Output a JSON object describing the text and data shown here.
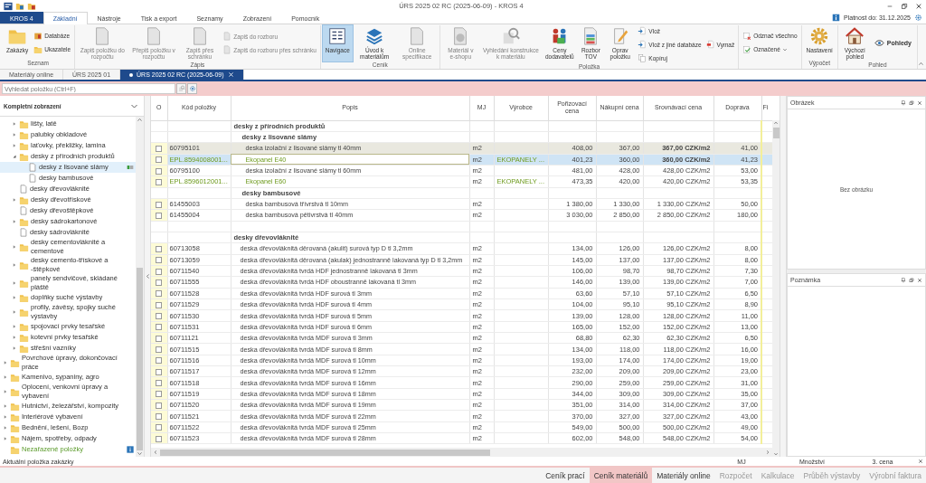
{
  "window": {
    "title": "ÚRS 2025 02 RC (2025-06-09) - KROS 4"
  },
  "ribbon_tabs": [
    {
      "label": "KROS 4",
      "kind": "app",
      "selected": false
    },
    {
      "label": "Základní",
      "kind": "tab",
      "selected": true
    },
    {
      "label": "Nástroje",
      "kind": "tab",
      "selected": false
    },
    {
      "label": "Tisk a export",
      "kind": "tab",
      "selected": false
    },
    {
      "label": "Seznamy",
      "kind": "tab",
      "selected": false
    },
    {
      "label": "Zobrazení",
      "kind": "tab",
      "selected": false
    },
    {
      "label": "Pomocník",
      "kind": "tab",
      "selected": false
    }
  ],
  "license": "Platnost do: 31.12.2025",
  "ribbon_groups": [
    {
      "label": "Seznam",
      "buttons": [
        {
          "label": "Zakázky",
          "kind": "large",
          "disabled": false,
          "selected": false,
          "dropdown": false
        },
        {
          "label": "Databáze",
          "kind": "small",
          "disabled": false,
          "selected": false,
          "dropdown": false
        },
        {
          "label": "Ukazatele",
          "kind": "small",
          "disabled": false,
          "selected": false,
          "dropdown": false
        }
      ]
    },
    {
      "label": "Zápis",
      "buttons": [
        {
          "label": "Zapiš položku do rozpočtu",
          "kind": "large",
          "disabled": true,
          "selected": false,
          "dropdown": false
        },
        {
          "label": "Přepiš položku v rozpočtu",
          "kind": "large",
          "disabled": true,
          "selected": false,
          "dropdown": false
        },
        {
          "label": "Zapiš přes schránku",
          "kind": "large",
          "disabled": true,
          "selected": false,
          "dropdown": false
        },
        {
          "label": "Zapiš do rozboru",
          "kind": "small",
          "disabled": true,
          "selected": false,
          "dropdown": false
        },
        {
          "label": "Zapiš do rozboru přes schránku",
          "kind": "small",
          "disabled": true,
          "selected": false,
          "dropdown": false
        }
      ]
    },
    {
      "label": "Ceník",
      "buttons": [
        {
          "label": "Navigace",
          "kind": "large",
          "disabled": false,
          "selected": true,
          "dropdown": false
        },
        {
          "label": "Úvod k materiálům",
          "kind": "large",
          "disabled": false,
          "selected": false,
          "dropdown": false
        },
        {
          "label": "Online specifikace",
          "kind": "large",
          "disabled": true,
          "selected": false,
          "dropdown": false
        }
      ]
    },
    {
      "label": "Položka",
      "buttons": [
        {
          "label": "Materiál v e-shopu",
          "kind": "large",
          "disabled": true,
          "selected": false,
          "dropdown": false
        },
        {
          "label": "Vyhledání konstrukce k materiálu",
          "kind": "large",
          "disabled": true,
          "selected": false,
          "dropdown": false
        },
        {
          "label": "Ceny dodavatelů",
          "kind": "large",
          "disabled": false,
          "selected": false,
          "dropdown": false
        },
        {
          "label": "Rozbor TOV",
          "kind": "large",
          "disabled": false,
          "selected": false,
          "dropdown": false
        },
        {
          "label": "Oprav položku",
          "kind": "large",
          "disabled": false,
          "selected": false,
          "dropdown": false
        },
        {
          "label": "Vlož",
          "kind": "small",
          "disabled": false,
          "selected": false,
          "dropdown": false
        },
        {
          "label": "Vlož z jiné databáze",
          "kind": "small",
          "disabled": false,
          "selected": false,
          "dropdown": false
        },
        {
          "label": "Kopíruj",
          "kind": "small",
          "disabled": false,
          "selected": false,
          "dropdown": false
        },
        {
          "label": "Vymaž",
          "kind": "single",
          "disabled": false,
          "selected": false,
          "dropdown": false
        }
      ]
    },
    {
      "buttons": [
        {
          "label": "Odznač všechno",
          "kind": "small",
          "disabled": false,
          "selected": false,
          "dropdown": false
        },
        {
          "label": "Označené",
          "kind": "small",
          "disabled": false,
          "selected": false,
          "dropdown": true
        }
      ]
    },
    {
      "label": "Výpočet",
      "buttons": [
        {
          "label": "Nastavení",
          "kind": "large",
          "disabled": false,
          "selected": false,
          "dropdown": false
        }
      ]
    },
    {
      "label": "Pohled",
      "buttons": [
        {
          "label": "Výchozí pohled",
          "kind": "large",
          "disabled": false,
          "selected": false,
          "dropdown": false
        },
        {
          "label": "Pohledy",
          "kind": "wide",
          "disabled": false,
          "selected": false,
          "dropdown": false
        }
      ]
    }
  ],
  "document_tabs": [
    {
      "label": "Materiály online",
      "selected": false,
      "modified": false,
      "closable": false
    },
    {
      "label": "ÚRS 2025 01",
      "selected": false,
      "modified": false,
      "closable": false
    },
    {
      "label": "ÚRS 2025 02 RC (2025-06-09)",
      "selected": true,
      "modified": true,
      "closable": true
    }
  ],
  "search": {
    "placeholder": "Vyhledat položku (Ctrl+F)"
  },
  "tree": {
    "header": "Kompletní zobrazení",
    "continued": [
      {
        "label": "lišty, latě",
        "kind": "folder",
        "expanded": false,
        "selected": false
      },
      {
        "label": "palubky obkladové",
        "kind": "folder",
        "expanded": false,
        "selected": false
      },
      {
        "label": "laťovky, překližky, lamina",
        "kind": "folder",
        "expanded": false,
        "selected": false
      },
      {
        "label": "desky z přírodních produktů",
        "kind": "folder",
        "expanded": true,
        "selected": false,
        "children": [
          {
            "label": "desky z lisované slámy",
            "kind": "document",
            "selected": true
          },
          {
            "label": "desky bambusové",
            "kind": "document",
            "selected": false
          }
        ]
      },
      {
        "label": "desky dřevovláknité",
        "kind": "document",
        "selected": false
      },
      {
        "label": "desky dřevotřískové",
        "kind": "folder",
        "expanded": false,
        "selected": false
      },
      {
        "label": "desky dřevoštěpkové",
        "kind": "document",
        "selected": false
      },
      {
        "label": "desky sádrokartonové",
        "kind": "folder",
        "expanded": false,
        "selected": false
      },
      {
        "label": "desky sádrovláknité",
        "kind": "document",
        "selected": false
      },
      {
        "label": "desky cementovláknité a cementové",
        "kind": "folder",
        "expanded": false,
        "selected": false
      },
      {
        "label": "desky cemento-třískové a -štěpkové",
        "kind": "folder",
        "expanded": false,
        "selected": false
      },
      {
        "label": "panely sendvičové, skládané pláště",
        "kind": "folder",
        "expanded": false,
        "selected": false
      },
      {
        "label": "doplňky suché výstavby",
        "kind": "folder",
        "expanded": false,
        "selected": false
      },
      {
        "label": "profily, závěsy, spojky suché výstavby",
        "kind": "folder",
        "expanded": false,
        "selected": false
      },
      {
        "label": "spojovací prvky tesařské",
        "kind": "folder",
        "expanded": false,
        "selected": false
      },
      {
        "label": "kotevní prvky tesařské",
        "kind": "folder",
        "expanded": false,
        "selected": false
      },
      {
        "label": "střešní vazníky",
        "kind": "folder",
        "expanded": false,
        "selected": false
      }
    ],
    "items": [
      {
        "label": "Povrchové úpravy, dokončovací práce",
        "kind": "folder",
        "expanded": false,
        "selected": false
      },
      {
        "label": "Kamenivo, sypaniny, agro",
        "kind": "folder",
        "expanded": false,
        "selected": false
      },
      {
        "label": "Oplocení, venkovní úpravy a vybavení",
        "kind": "folder",
        "expanded": false,
        "selected": false
      },
      {
        "label": "Hutnictví, železářství, kompozity",
        "kind": "folder",
        "expanded": false,
        "selected": false
      },
      {
        "label": "Interiérové vybavení",
        "kind": "folder",
        "expanded": false,
        "selected": false
      },
      {
        "label": "Bednění, lešení, Bozp",
        "kind": "folder",
        "expanded": false,
        "selected": false
      },
      {
        "label": "Nájem, spotřeby, odpady",
        "kind": "folder",
        "expanded": false,
        "selected": false
      },
      {
        "label": "Nezařazené položky",
        "kind": "unassigned",
        "selected": false
      }
    ]
  },
  "table": {
    "columns": [
      "O",
      "Kód položky",
      "Popis",
      "MJ",
      "Výrobce",
      "Pořizovací cena",
      "Nákupní cena",
      "Srovnávací cena",
      "Doprava",
      "Fi"
    ],
    "groups": [
      {
        "title": "desky z přírodních produktů",
        "subgroups": [
          {
            "title": "desky z lisované slámy",
            "rows": [
              {
                "code": "60795101",
                "description": "deska izolační z lisované slámy tl 40mm",
                "unit": "m2",
                "purchase_price": "408,00",
                "buy_price": "367,00",
                "compare_price": "367,00 CZK/m2",
                "transport": "41,00",
                "kind": "standard",
                "checked": false,
                "current": true,
                "selected": false
              },
              {
                "code": "EPL.8594008001...",
                "description": "Ekopanel E40",
                "unit": "m2",
                "manufacturer": "EKOPANELY ...",
                "purchase_price": "401,23",
                "buy_price": "360,00",
                "compare_price": "360,00 CZK/m2",
                "transport": "41,23",
                "kind": "online",
                "checked": false,
                "current": false,
                "selected": true
              },
              {
                "code": "60795100",
                "description": "deska izolační z lisované slámy tl 60mm",
                "unit": "m2",
                "purchase_price": "481,00",
                "buy_price": "428,00",
                "compare_price": "428,00 CZK/m2",
                "transport": "53,00",
                "kind": "standard",
                "checked": false,
                "current": false,
                "selected": false
              },
              {
                "code": "EPL.8596012001...",
                "description": "Ekopanel E60",
                "unit": "m2",
                "manufacturer": "EKOPANELY ...",
                "purchase_price": "473,35",
                "buy_price": "420,00",
                "compare_price": "420,00 CZK/m2",
                "transport": "53,35",
                "kind": "online",
                "checked": false,
                "current": false,
                "selected": false
              }
            ]
          },
          {
            "title": "desky bambusové",
            "rows": [
              {
                "code": "61455003",
                "description": "deska bambusová třívrstvá tl 10mm",
                "unit": "m2",
                "purchase_price": "1 380,00",
                "buy_price": "1 330,00",
                "compare_price": "1 330,00 CZK/m2",
                "transport": "50,00",
                "kind": "standard",
                "checked": false,
                "current": false,
                "selected": false
              },
              {
                "code": "61455004",
                "description": "deska bambusová pětivrstvá tl 40mm",
                "unit": "m2",
                "purchase_price": "3 030,00",
                "buy_price": "2 850,00",
                "compare_price": "2 850,00 CZK/m2",
                "transport": "180,00",
                "kind": "standard",
                "checked": false,
                "current": false,
                "selected": false
              }
            ]
          }
        ]
      },
      {
        "title": "desky dřevovláknité",
        "rows": [
          {
            "code": "60713058",
            "description": "deska dřevovláknitá děrovaná (akulit) surová typ D tl 3,2mm",
            "unit": "m2",
            "purchase_price": "134,00",
            "buy_price": "126,00",
            "compare_price": "126,00 CZK/m2",
            "transport": "8,00",
            "kind": "standard",
            "checked": false,
            "current": false,
            "selected": false
          },
          {
            "code": "60713059",
            "description": "deska dřevovláknitá děrovaná (akulak) jednostranně lakovaná typ D tl 3,2mm",
            "unit": "m2",
            "purchase_price": "145,00",
            "buy_price": "137,00",
            "compare_price": "137,00 CZK/m2",
            "transport": "8,00",
            "kind": "standard",
            "checked": false,
            "current": false,
            "selected": false
          },
          {
            "code": "60711540",
            "description": "deska dřevovláknitá tvrdá HDF jednostranně lakovaná tl 3mm",
            "unit": "m2",
            "purchase_price": "106,00",
            "buy_price": "98,70",
            "compare_price": "98,70 CZK/m2",
            "transport": "7,30",
            "kind": "standard",
            "checked": false,
            "current": false,
            "selected": false
          },
          {
            "code": "60711555",
            "description": "deska dřevovláknitá tvrdá HDF oboustranně lakovaná tl 3mm",
            "unit": "m2",
            "purchase_price": "146,00",
            "buy_price": "139,00",
            "compare_price": "139,00 CZK/m2",
            "transport": "7,00",
            "kind": "standard",
            "checked": false,
            "current": false,
            "selected": false
          },
          {
            "code": "60711528",
            "description": "deska dřevovláknitá tvrdá HDF surová tl 3mm",
            "unit": "m2",
            "purchase_price": "63,60",
            "buy_price": "57,10",
            "compare_price": "57,10 CZK/m2",
            "transport": "6,50",
            "kind": "standard",
            "checked": false,
            "current": false,
            "selected": false
          },
          {
            "code": "60711529",
            "description": "deska dřevovláknitá tvrdá HDF surová tl 4mm",
            "unit": "m2",
            "purchase_price": "104,00",
            "buy_price": "95,10",
            "compare_price": "95,10 CZK/m2",
            "transport": "8,90",
            "kind": "standard",
            "checked": false,
            "current": false,
            "selected": false
          },
          {
            "code": "60711530",
            "description": "deska dřevovláknitá tvrdá HDF surová tl 5mm",
            "unit": "m2",
            "purchase_price": "139,00",
            "buy_price": "128,00",
            "compare_price": "128,00 CZK/m2",
            "transport": "11,00",
            "kind": "standard",
            "checked": false,
            "current": false,
            "selected": false
          },
          {
            "code": "60711531",
            "description": "deska dřevovláknitá tvrdá HDF surová tl 6mm",
            "unit": "m2",
            "purchase_price": "165,00",
            "buy_price": "152,00",
            "compare_price": "152,00 CZK/m2",
            "transport": "13,00",
            "kind": "standard",
            "checked": false,
            "current": false,
            "selected": false
          },
          {
            "code": "60711121",
            "description": "deska dřevovláknitá tvrdá MDF surová tl 3mm",
            "unit": "m2",
            "purchase_price": "68,80",
            "buy_price": "62,30",
            "compare_price": "62,30 CZK/m2",
            "transport": "6,50",
            "kind": "standard",
            "checked": false,
            "current": false,
            "selected": false
          },
          {
            "code": "60711515",
            "description": "deska dřevovláknitá tvrdá MDF surová tl 8mm",
            "unit": "m2",
            "purchase_price": "134,00",
            "buy_price": "118,00",
            "compare_price": "118,00 CZK/m2",
            "transport": "16,00",
            "kind": "standard",
            "checked": false,
            "current": false,
            "selected": false
          },
          {
            "code": "60711516",
            "description": "deska dřevovláknitá tvrdá MDF surová tl 10mm",
            "unit": "m2",
            "purchase_price": "193,00",
            "buy_price": "174,00",
            "compare_price": "174,00 CZK/m2",
            "transport": "19,00",
            "kind": "standard",
            "checked": false,
            "current": false,
            "selected": false
          },
          {
            "code": "60711517",
            "description": "deska dřevovláknitá tvrdá MDF surová tl 12mm",
            "unit": "m2",
            "purchase_price": "232,00",
            "buy_price": "209,00",
            "compare_price": "209,00 CZK/m2",
            "transport": "23,00",
            "kind": "standard",
            "checked": false,
            "current": false,
            "selected": false
          },
          {
            "code": "60711518",
            "description": "deska dřevovláknitá tvrdá MDF surová tl 16mm",
            "unit": "m2",
            "purchase_price": "290,00",
            "buy_price": "259,00",
            "compare_price": "259,00 CZK/m2",
            "transport": "31,00",
            "kind": "standard",
            "checked": false,
            "current": false,
            "selected": false
          },
          {
            "code": "60711519",
            "description": "deska dřevovláknitá tvrdá MDF surová tl 18mm",
            "unit": "m2",
            "purchase_price": "344,00",
            "buy_price": "309,00",
            "compare_price": "309,00 CZK/m2",
            "transport": "35,00",
            "kind": "standard",
            "checked": false,
            "current": false,
            "selected": false
          },
          {
            "code": "60711520",
            "description": "deska dřevovláknitá tvrdá MDF surová tl 19mm",
            "unit": "m2",
            "purchase_price": "351,00",
            "buy_price": "314,00",
            "compare_price": "314,00 CZK/m2",
            "transport": "37,00",
            "kind": "standard",
            "checked": false,
            "current": false,
            "selected": false
          },
          {
            "code": "60711521",
            "description": "deska dřevovláknitá tvrdá MDF surová tl 22mm",
            "unit": "m2",
            "purchase_price": "370,00",
            "buy_price": "327,00",
            "compare_price": "327,00 CZK/m2",
            "transport": "43,00",
            "kind": "standard",
            "checked": false,
            "current": false,
            "selected": false
          },
          {
            "code": "60711522",
            "description": "deska dřevovláknitá tvrdá MDF surová tl 25mm",
            "unit": "m2",
            "purchase_price": "549,00",
            "buy_price": "500,00",
            "compare_price": "500,00 CZK/m2",
            "transport": "49,00",
            "kind": "standard",
            "checked": false,
            "current": false,
            "selected": false
          },
          {
            "code": "60711523",
            "description": "deska dřevovláknitá tvrdá MDF surová tl 28mm",
            "unit": "m2",
            "purchase_price": "602,00",
            "buy_price": "548,00",
            "compare_price": "548,00 CZK/m2",
            "transport": "54,00",
            "kind": "standard",
            "checked": false,
            "current": false,
            "selected": false
          }
        ]
      }
    ]
  },
  "panels": [
    {
      "title": "Obrázek",
      "empty_text": "Bez obrázku"
    },
    {
      "title": "Poznámka"
    }
  ],
  "status_bar": {
    "text": "Aktuální položka zakázky",
    "columns": [
      "MJ",
      "Množství",
      "3. cena"
    ]
  },
  "bottom_tabs": [
    {
      "label": "Ceník prací",
      "selected": false,
      "disabled": false
    },
    {
      "label": "Ceník materiálů",
      "selected": true,
      "disabled": false
    },
    {
      "label": "Materiály online",
      "selected": false,
      "disabled": false
    },
    {
      "label": "Rozpočet",
      "selected": false,
      "disabled": true
    },
    {
      "label": "Kalkulace",
      "selected": false,
      "disabled": true
    },
    {
      "label": "Průběh výstavby",
      "selected": false,
      "disabled": true
    },
    {
      "label": "Výrobní faktura",
      "selected": false,
      "disabled": true
    }
  ]
}
